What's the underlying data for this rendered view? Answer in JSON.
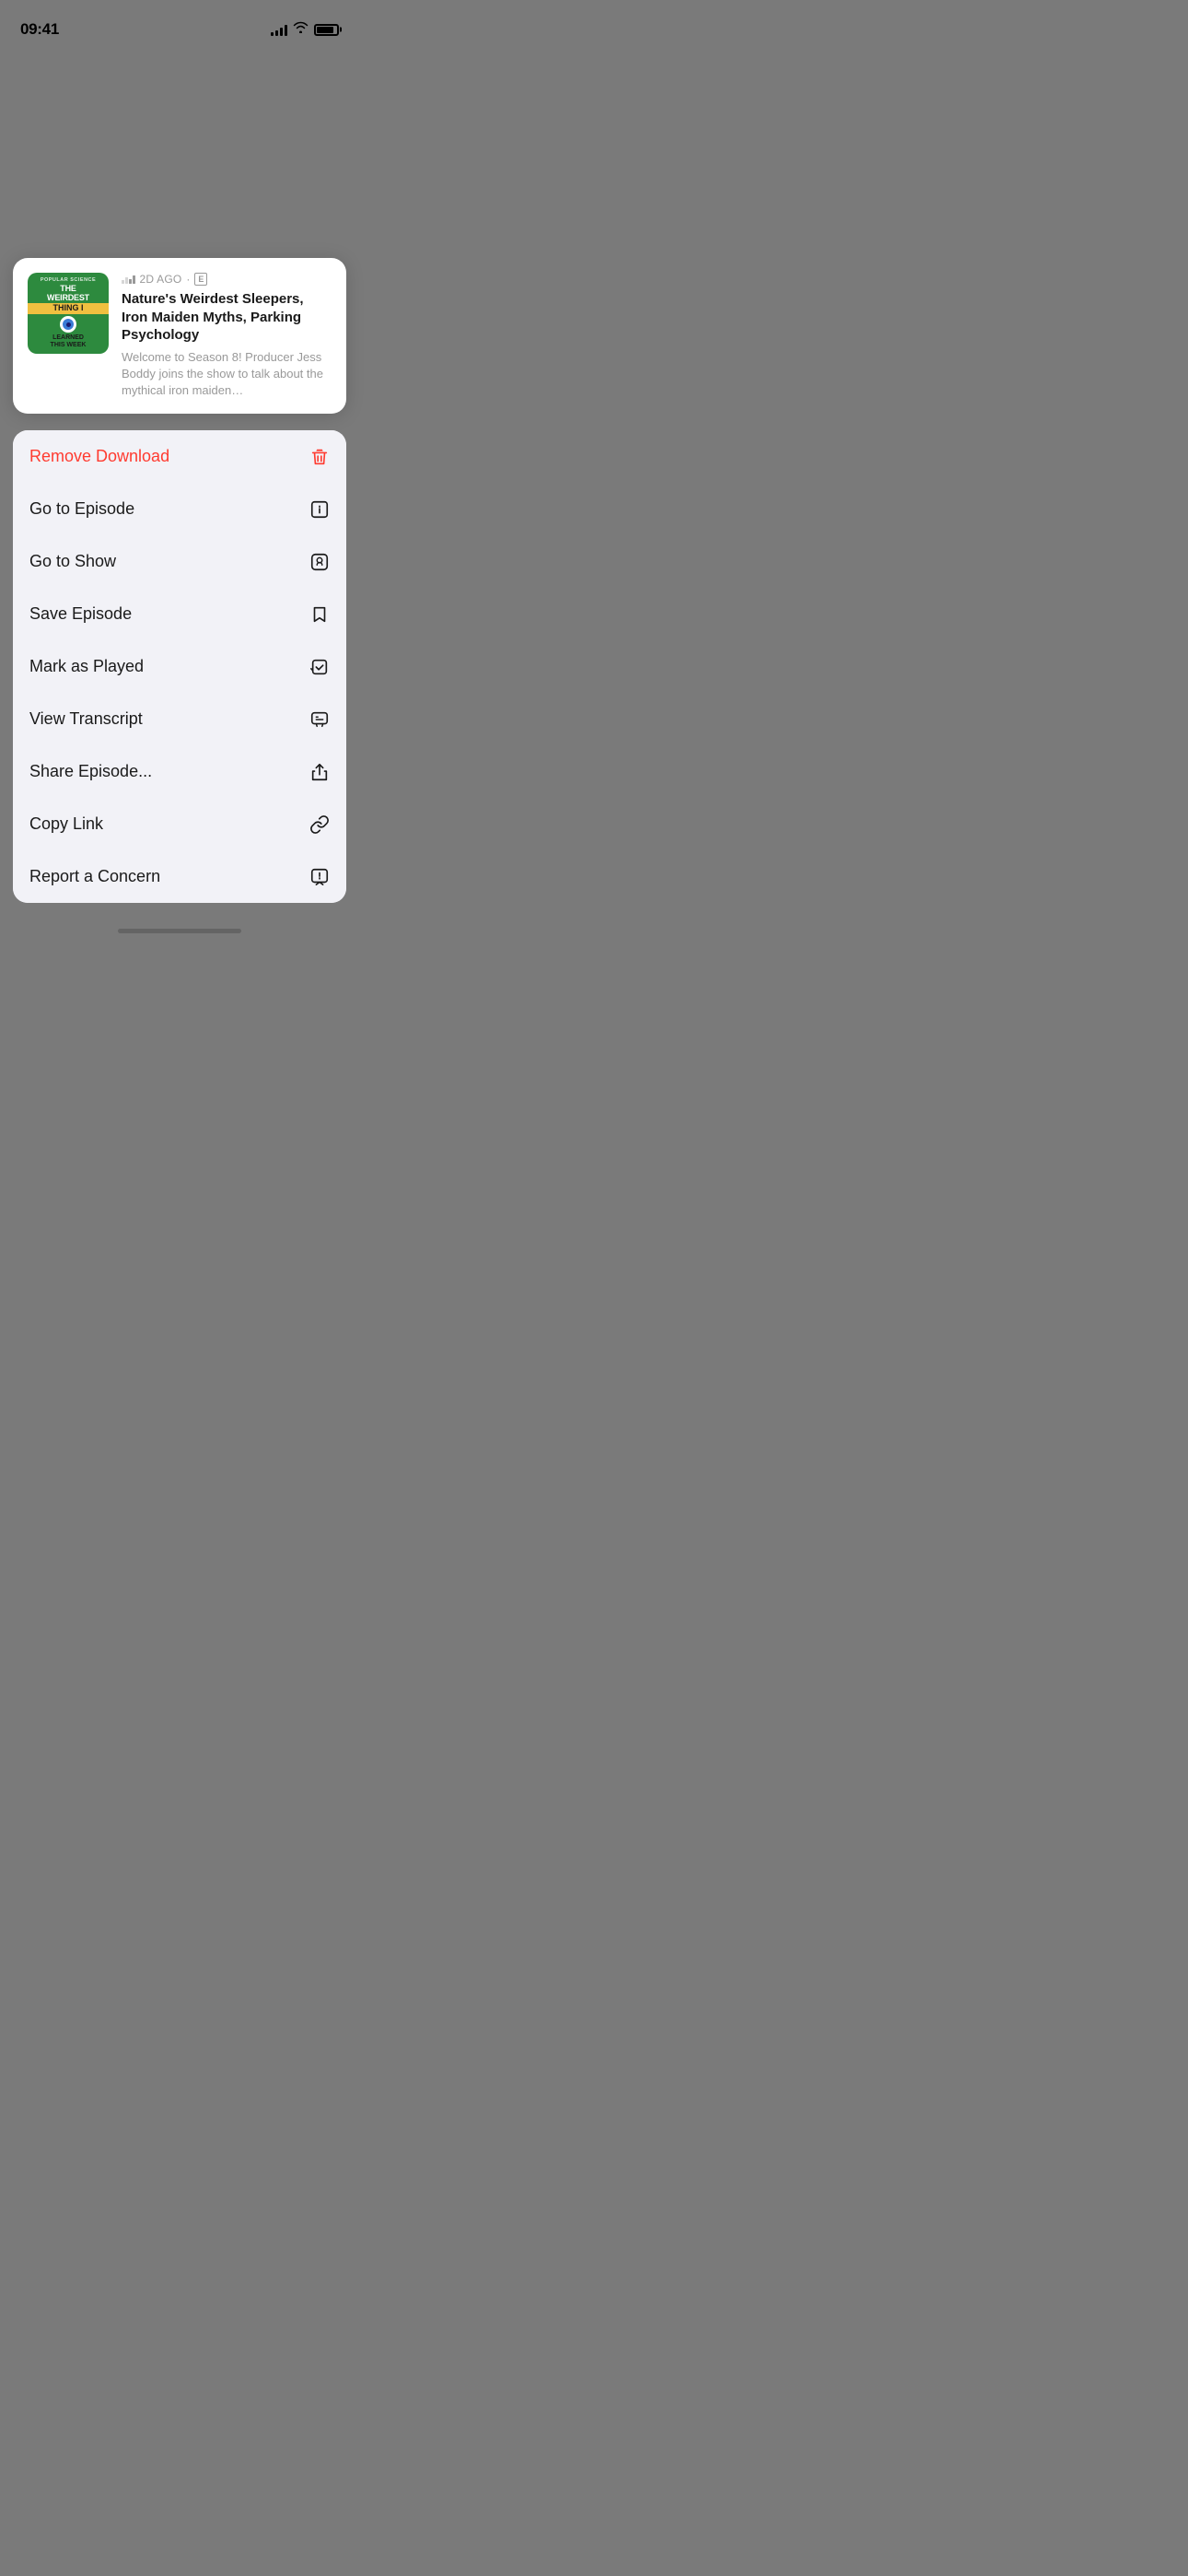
{
  "statusBar": {
    "time": "09:41",
    "signalBars": [
      4,
      6,
      8,
      10,
      12
    ],
    "batteryLevel": 85
  },
  "episodeCard": {
    "artwork": {
      "label": "POPULAR SCIENCE",
      "titleLine1": "THE",
      "titleLine2": "WEIRDEST",
      "titleLine3": "THING I",
      "titleLine4": "LEARNED",
      "titleLine5": "THIS WEEK"
    },
    "meta": {
      "timestamp": "2D AGO",
      "explicit": "E"
    },
    "title": "Nature's Weirdest Sleepers, Iron Maiden Myths, Parking Psychology",
    "description": "Welcome to Season 8! Producer Jess Boddy joins the show to talk about the mythical iron maiden…"
  },
  "contextMenu": {
    "items": [
      {
        "id": "remove-download",
        "label": "Remove Download",
        "destructive": true,
        "icon": "trash"
      },
      {
        "id": "go-to-episode",
        "label": "Go to Episode",
        "destructive": false,
        "icon": "info"
      },
      {
        "id": "go-to-show",
        "label": "Go to Show",
        "destructive": false,
        "icon": "podcast"
      },
      {
        "id": "save-episode",
        "label": "Save Episode",
        "destructive": false,
        "icon": "bookmark"
      },
      {
        "id": "mark-as-played",
        "label": "Mark as Played",
        "destructive": false,
        "icon": "checkmark-square"
      },
      {
        "id": "view-transcript",
        "label": "View Transcript",
        "destructive": false,
        "icon": "quote-bubble"
      },
      {
        "id": "share-episode",
        "label": "Share Episode...",
        "destructive": false,
        "icon": "share"
      },
      {
        "id": "copy-link",
        "label": "Copy Link",
        "destructive": false,
        "icon": "link"
      },
      {
        "id": "report-concern",
        "label": "Report a Concern",
        "destructive": false,
        "icon": "exclamation-bubble"
      }
    ]
  }
}
